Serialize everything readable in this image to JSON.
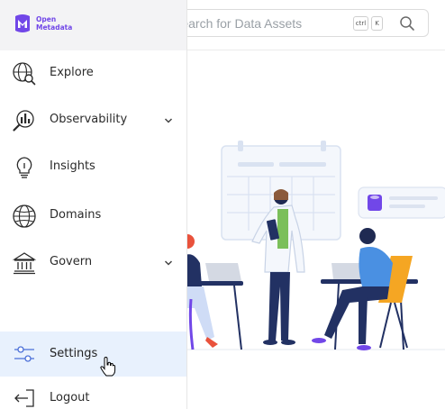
{
  "brand": {
    "logo_line1": "Open",
    "logo_line2": "Metadata",
    "accent": "#7147e8"
  },
  "search": {
    "placeholder": "Search for Data Assets",
    "shortcut_ctrl": "ctrl",
    "shortcut_key": "K",
    "icon": "search-icon"
  },
  "sidebar": {
    "items": [
      {
        "label": "Explore",
        "icon": "explore-globe-search-icon",
        "has_chevron": false
      },
      {
        "label": "Observability",
        "icon": "observability-icon",
        "has_chevron": true
      },
      {
        "label": "Insights",
        "icon": "lightbulb-icon",
        "has_chevron": false
      },
      {
        "label": "Domains",
        "icon": "globe-icon",
        "has_chevron": false
      },
      {
        "label": "Govern",
        "icon": "bank-icon",
        "has_chevron": true
      }
    ],
    "settings": {
      "label": "Settings",
      "icon": "sliders-icon",
      "active": true
    },
    "logout": {
      "label": "Logout",
      "icon": "logout-arrow-icon"
    }
  },
  "colors": {
    "active_bg": "#e8f1fd",
    "text": "#2b2b2b",
    "illustration_accent": "#7147e8"
  }
}
